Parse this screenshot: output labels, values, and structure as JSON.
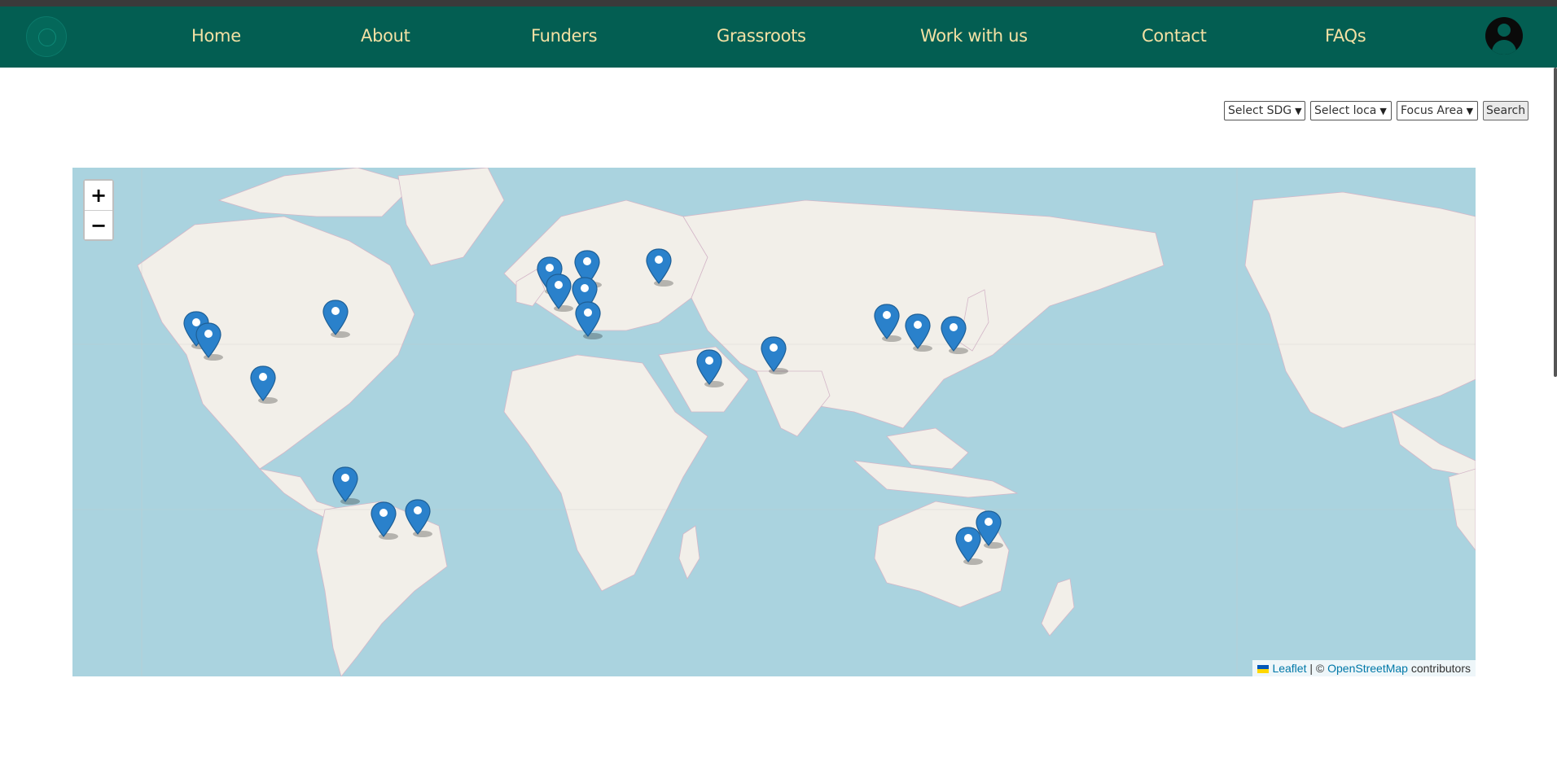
{
  "nav": {
    "items": [
      "Home",
      "About",
      "Funders",
      "Grassroots",
      "Work with us",
      "Contact",
      "FAQs"
    ]
  },
  "filters": {
    "sdg": "Select SDG",
    "location": "Select loca",
    "focus": "Focus Area",
    "search": "Search"
  },
  "map": {
    "zoom_in": "+",
    "zoom_out": "−",
    "attribution": {
      "leaflet": "Leaflet",
      "separator": "| ©",
      "osm": "OpenStreetMap",
      "suffix": "contributors"
    },
    "marker_icon": "map-pin-icon",
    "marker_color": "#2a81cb"
  },
  "colors": {
    "navbar": "#035e52",
    "nav_text": "#f3e1a4",
    "water": "#aad3df",
    "land": "#f2efe9"
  }
}
